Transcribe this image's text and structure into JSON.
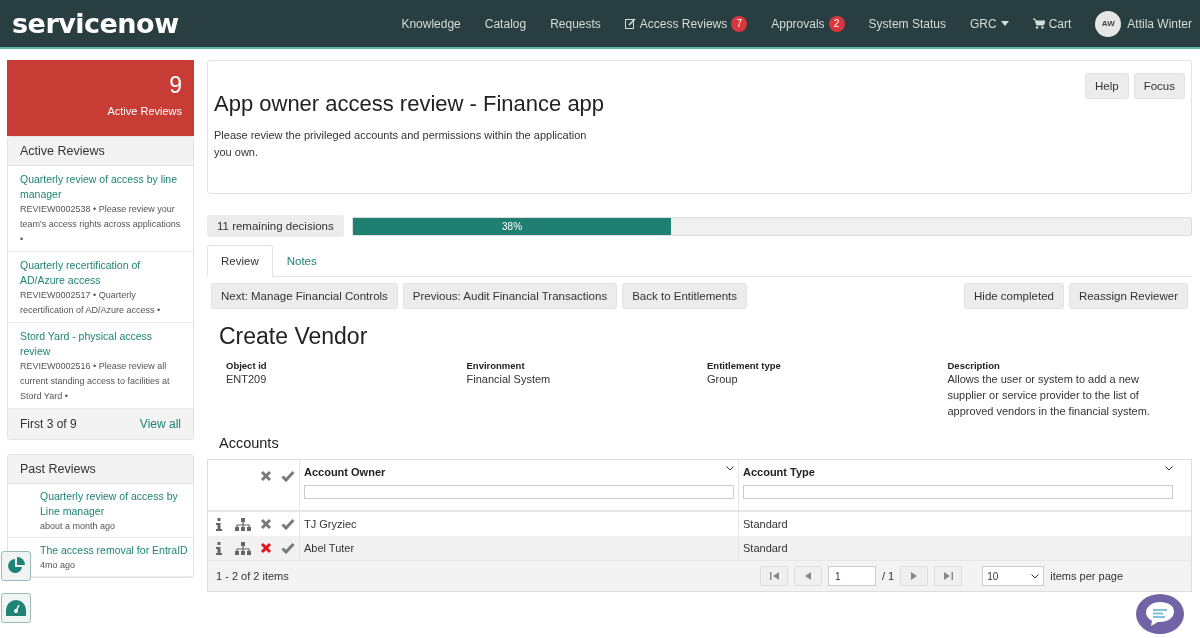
{
  "header": {
    "logo": "servicenow",
    "nav": [
      {
        "kind": "link",
        "label": "Knowledge"
      },
      {
        "kind": "link",
        "label": "Catalog"
      },
      {
        "kind": "link",
        "label": "Requests"
      },
      {
        "kind": "edit",
        "label": "Access Reviews",
        "badge": "7"
      },
      {
        "kind": "link",
        "label": "Approvals",
        "badge": "2"
      },
      {
        "kind": "link",
        "label": "System Status"
      },
      {
        "kind": "dropdown",
        "label": "GRC"
      },
      {
        "kind": "cart",
        "label": "Cart"
      }
    ],
    "user": {
      "initials": "AW",
      "name": "Attila Winter"
    }
  },
  "sidebar": {
    "summary": {
      "count": "9",
      "label": "Active Reviews"
    },
    "active_reviews": {
      "title": "Active Reviews",
      "items": [
        {
          "title": "Quarterly review of access by line manager",
          "meta": "REVIEW0002538 • Please review your team's access rights across applications •"
        },
        {
          "title": "Quarterly recertification of AD/Azure access",
          "meta": "REVIEW0002517 • Quarterly recertification of AD/Azure access •"
        },
        {
          "title": "Stord Yard - physical access review",
          "meta": "REVIEW0002516 • Please review all current standing access to facilities at Stord Yard •"
        }
      ],
      "footer": "First 3 of 9",
      "link": "View all"
    },
    "past_reviews": {
      "title": "Past Reviews",
      "items": [
        {
          "title": "Quarterly review of access by Line manager",
          "meta": "about a month ago"
        },
        {
          "title": "The access removal for EntraID",
          "meta": "4mo ago"
        }
      ]
    }
  },
  "review": {
    "title": "App owner access review - Finance app",
    "description": "Please review the privileged accounts and permissions within the application you own.",
    "buttons": [
      "Help",
      "Focus"
    ]
  },
  "progress": {
    "remaining": "11 remaining decisions",
    "level": 0.38,
    "label": "38%"
  },
  "tabs": [
    {
      "label": "Review",
      "selected": true
    },
    {
      "label": "Notes",
      "selected": false
    }
  ],
  "actions_left": [
    "Next: Manage Financial Controls",
    "Previous: Audit Financial Transactions",
    "Back to Entitlements"
  ],
  "actions_right": [
    "Hide completed",
    "Reassign Reviewer"
  ],
  "entitlement": {
    "title": "Create Vendor",
    "fields": [
      {
        "label": "Object id",
        "value": "ENT209"
      },
      {
        "label": "Environment",
        "value": "Financial System"
      },
      {
        "label": "Entitlement type",
        "value": "Group"
      },
      {
        "label": "Description",
        "value": "Allows the user or system to add a new supplier or service provider to the list of approved vendors in the financial system."
      }
    ]
  },
  "accounts": {
    "title": "Accounts",
    "columns": [
      "Account Owner",
      "Account Type"
    ],
    "rows": [
      {
        "owner": "TJ Gryziec",
        "type": "Standard",
        "rejected": false
      },
      {
        "owner": "Abel Tuter",
        "type": "Standard",
        "rejected": true
      }
    ],
    "summary": "1 - 2 of 2 items",
    "page": "1",
    "pages": "/ 1",
    "page_size": "10",
    "page_size_label": "items per page"
  }
}
